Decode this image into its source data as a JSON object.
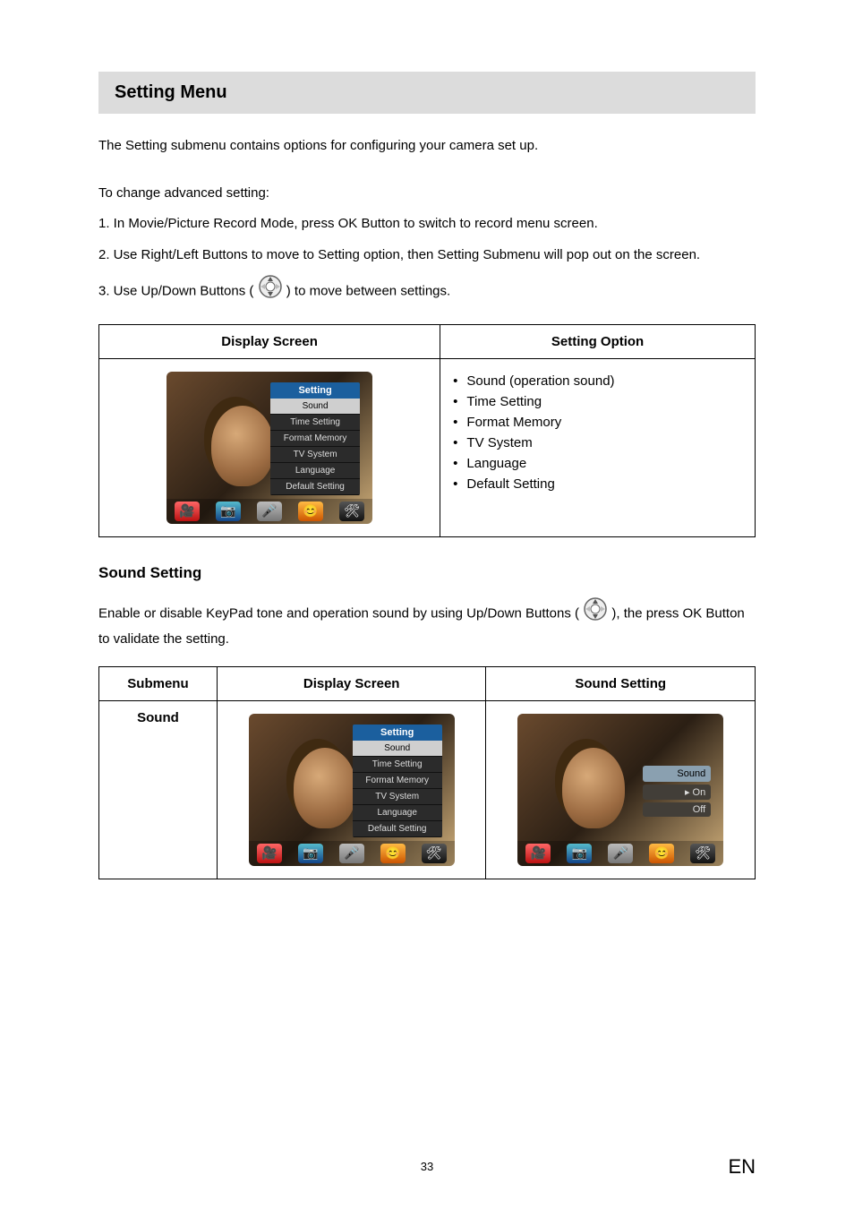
{
  "header": {
    "title": "Setting Menu"
  },
  "intro": "The Setting submenu contains options for configuring your camera set up.",
  "steps": {
    "lead": "To change advanced setting:",
    "s1": "1. In Movie/Picture Record Mode, press OK Button to switch to record menu screen.",
    "s2": "2. Use Right/Left Buttons to move to Setting option, then Setting Submenu will pop out on the screen.",
    "s3a": "3. Use Up/Down Buttons ( ",
    "s3b": " ) to move between settings."
  },
  "table1": {
    "col1": "Display Screen",
    "col2": "Setting Option",
    "menu": {
      "title": "Setting",
      "items": [
        "Sound",
        "Time Setting",
        "Format Memory",
        "TV System",
        "Language",
        "Default Setting"
      ],
      "selectedIndex": 0
    },
    "options": [
      "Sound (operation sound)",
      "Time Setting",
      "Format Memory",
      "TV System",
      "Language",
      "Default Setting"
    ]
  },
  "sound": {
    "heading": "Sound Setting",
    "desc_a": "Enable or disable KeyPad tone and operation sound by using Up/Down Buttons ( ",
    "desc_b": " ), the press OK Button to validate the setting."
  },
  "table2": {
    "col1": "Submenu",
    "col2": "Display Screen",
    "col3": "Sound Setting",
    "submenu_label": "Sound",
    "menu": {
      "title": "Setting",
      "items": [
        "Sound",
        "Time Setting",
        "Format Memory",
        "TV System",
        "Language",
        "Default Setting"
      ],
      "selectedIndex": 0
    },
    "sound_panel": {
      "title": "Sound",
      "options": [
        "On",
        "Off"
      ],
      "selectedIndex": 0
    }
  },
  "page": {
    "num": "33",
    "lang": "EN"
  }
}
